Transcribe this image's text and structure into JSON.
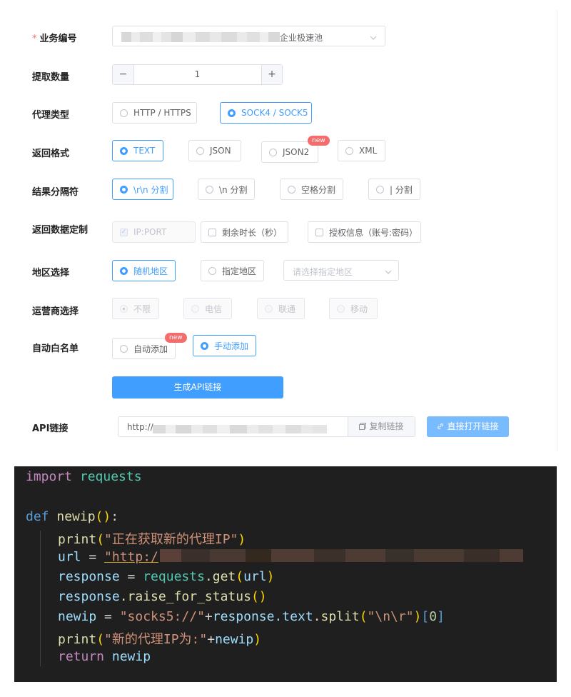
{
  "form": {
    "business_no": {
      "label": "业务编号",
      "required_mark": "*",
      "selected_value": "企业极速池"
    },
    "quantity": {
      "label": "提取数量",
      "value": "1",
      "minus": "−",
      "plus": "+"
    },
    "proxy_type": {
      "label": "代理类型",
      "options": [
        "HTTP / HTTPS",
        "SOCK4 / SOCK5"
      ],
      "selected": "SOCK4 / SOCK5"
    },
    "return_format": {
      "label": "返回格式",
      "options": [
        "TEXT",
        "JSON",
        "JSON2",
        "XML"
      ],
      "selected": "TEXT",
      "new_badge": "new"
    },
    "separator": {
      "label": "结果分隔符",
      "options": [
        "\\r\\n 分割",
        "\\n 分割",
        "空格分割",
        "| 分割"
      ],
      "selected": "\\r\\n 分割"
    },
    "custom_data": {
      "label": "返回数据定制",
      "options": [
        "IP:PORT",
        "剩余时长（秒）",
        "授权信息（账号:密码）"
      ],
      "checked": "IP:PORT"
    },
    "region": {
      "label": "地区选择",
      "options": [
        "随机地区",
        "指定地区"
      ],
      "selected": "随机地区",
      "select_placeholder": "请选择指定地区"
    },
    "carrier": {
      "label": "运营商选择",
      "options": [
        "不限",
        "电信",
        "联通",
        "移动"
      ],
      "selected": "不限"
    },
    "whitelist": {
      "label": "自动白名单",
      "options": [
        "自动添加",
        "手动添加"
      ],
      "selected": "手动添加",
      "new_badge": "new"
    },
    "generate_button": "生成API链接",
    "api_link": {
      "label": "API链接",
      "value_prefix": "http://v",
      "copy_button": "复制链接",
      "open_button": "直接打开链接"
    }
  },
  "code": {
    "l1_kw": "import",
    "l1_mod": "requests",
    "l3_kw": "def",
    "l3_fn": "newip",
    "l3_rest": "():",
    "l4_fn": "print",
    "l4_str": "\"正在获取新的代理IP\"",
    "l5_var": "url",
    "l5_eq": " = ",
    "l5_str": "\"http:/",
    "l6_var": "response",
    "l6_eq": " = ",
    "l6_mod": "requests",
    "l6_fn": ".get",
    "l6_arg": "url",
    "l7_var": "response",
    "l7_fn": ".raise_for_status",
    "l7_rest": "()",
    "l8_var": "newip",
    "l8_eq": " = ",
    "l8_str": "\"socks5://\"",
    "l8_op": "+",
    "l8_var2": "response",
    "l8_attr": ".text",
    "l8_fn": ".split",
    "l8_str2": "\"\\n\\r\"",
    "l8_idx": "0",
    "l9_fn": "print",
    "l9_str": "\"新的代理IP为:\"",
    "l9_op": "+",
    "l9_var": "newip",
    "l10_kw": "return",
    "l10_var": "newip"
  }
}
